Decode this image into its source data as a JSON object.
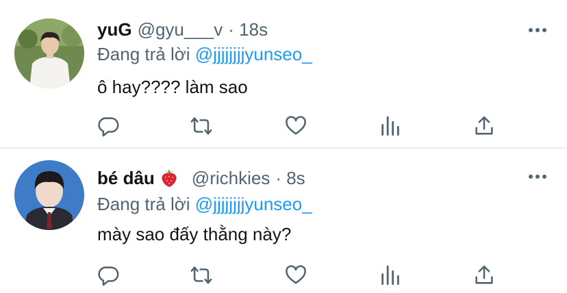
{
  "colors": {
    "accent": "#1d9bf0",
    "text": "#0f1419",
    "muted": "#536471",
    "divider": "#e6ecf0"
  },
  "tweets": [
    {
      "name": "yuG",
      "handle": "@gyu___v",
      "time": "· 18s",
      "reply_prefix": "Đang trả lời ",
      "reply_to": "@jjjjjjjjyunseo_",
      "text": "ô hay???? làm sao",
      "avatar": "avatar-photo"
    },
    {
      "name": "bé dâu",
      "emoji": "strawberry-icon",
      "handle": "@richkies",
      "time": "· 8s",
      "reply_prefix": "Đang trả lời ",
      "reply_to": "@jjjjjjjjyunseo_",
      "text": "mày sao đấy thằng này?",
      "avatar": "avatar-photo"
    }
  ],
  "actions": [
    "reply-icon",
    "retweet-icon",
    "like-icon",
    "stats-icon",
    "share-icon"
  ]
}
